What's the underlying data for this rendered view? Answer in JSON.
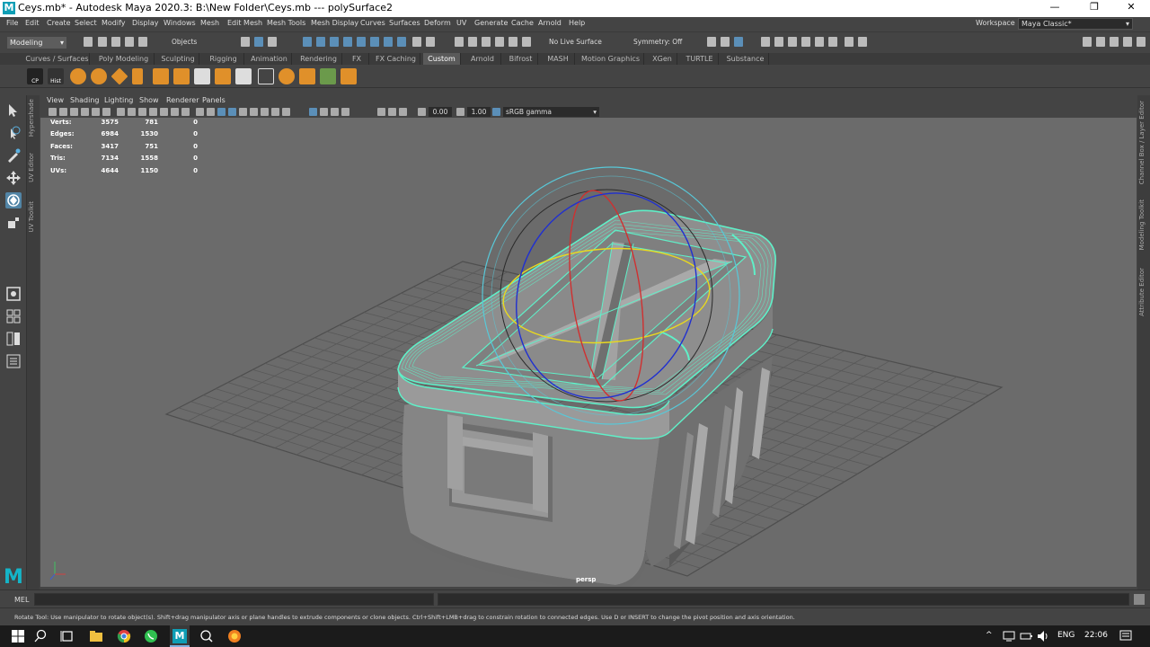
{
  "window": {
    "app_icon_letter": "M",
    "title": "Ceys.mb* - Autodesk Maya 2020.3: B:\\New Folder\\Ceys.mb   ---   polySurface2",
    "minimize": "—",
    "maximize": "❐",
    "close": "✕"
  },
  "menubar": {
    "items": [
      "File",
      "Edit",
      "Create",
      "Select",
      "Modify",
      "Display",
      "Windows",
      "Mesh",
      "Edit Mesh",
      "Mesh Tools",
      "Mesh Display",
      "Curves",
      "Surfaces",
      "Deform",
      "UV",
      "Generate",
      "Cache",
      "Arnold",
      "Help"
    ],
    "workspace_label": "Workspace :",
    "workspace_value": "Maya Classic*"
  },
  "statusline": {
    "mode": "Modeling",
    "objects_label": "Objects",
    "live_surface": "No Live Surface",
    "symmetry": "Symmetry: Off"
  },
  "shelf": {
    "tabs": [
      "Curves / Surfaces",
      "Poly Modeling",
      "Sculpting",
      "Rigging",
      "Animation",
      "Rendering",
      "FX",
      "FX Caching",
      "Custom",
      "Arnold",
      "Bifrost",
      "MASH",
      "Motion Graphics",
      "XGen",
      "TURTLE",
      "Substance"
    ],
    "active_tab": "Custom",
    "cp_label": "CP",
    "hist_label": "Hist"
  },
  "left_panel_tabs": [
    "Hypershade",
    "UV Editor",
    "UV Toolkit"
  ],
  "right_panel_tabs": [
    "Channel Box / Layer Editor",
    "Modeling Toolkit",
    "Attribute Editor"
  ],
  "viewport": {
    "menu": [
      "View",
      "Shading",
      "Lighting",
      "Show",
      "Renderer",
      "Panels"
    ],
    "exposure": "0.00",
    "gamma": "1.00",
    "color_space": "sRGB gamma",
    "camera": "persp",
    "hud": [
      {
        "label": "Verts:",
        "c1": "3575",
        "c2": "781",
        "c3": "0"
      },
      {
        "label": "Edges:",
        "c1": "6984",
        "c2": "1530",
        "c3": "0"
      },
      {
        "label": "Faces:",
        "c1": "3417",
        "c2": "751",
        "c3": "0"
      },
      {
        "label": "Tris:",
        "c1": "7134",
        "c2": "1558",
        "c3": "0"
      },
      {
        "label": "UVs:",
        "c1": "4644",
        "c2": "1150",
        "c3": "0"
      }
    ]
  },
  "command_line": {
    "label": "MEL"
  },
  "help_line": "Rotate Tool: Use manipulator to rotate object(s). Shift+drag manipulator axis or plane handles to extrude components or clone objects. Ctrl+Shift+LMB+drag to constrain rotation to connected edges. Use D or INSERT to change the pivot position and axis orientation.",
  "taskbar": {
    "language": "ENG",
    "time": "22:06"
  },
  "colors": {
    "selection": "#5ff0c8",
    "manip_outer": "#58c8d8",
    "rot_x": "#d03030",
    "rot_y": "#e8d820",
    "rot_z": "#2030d0",
    "accent": "#5285a6"
  }
}
